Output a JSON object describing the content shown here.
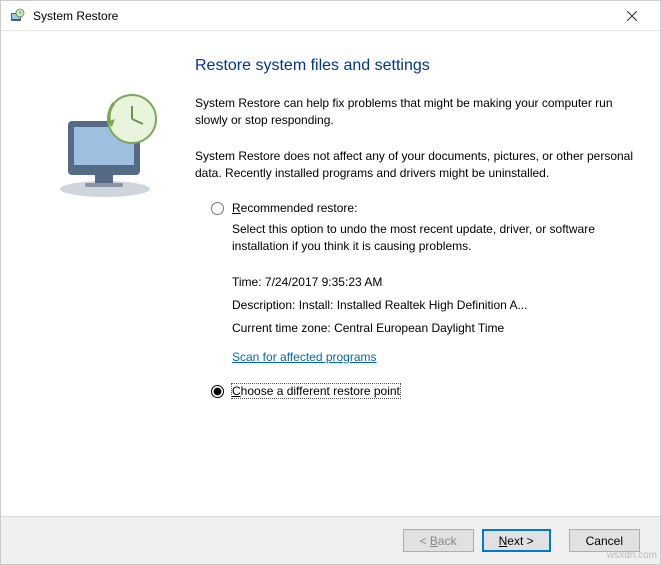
{
  "window": {
    "title": "System Restore"
  },
  "heading": "Restore system files and settings",
  "description1": "System Restore can help fix problems that might be making your computer run slowly or stop responding.",
  "description2": "System Restore does not affect any of your documents, pictures, or other personal data. Recently installed programs and drivers might be uninstalled.",
  "options": {
    "recommended": {
      "label": "Recommended restore:",
      "desc": "Select this option to undo the most recent update, driver, or software installation if you think it is causing problems.",
      "time_label": "Time:",
      "time_value": "7/24/2017 9:35:23 AM",
      "desc_label": "Description:",
      "desc_value": "Install: Installed Realtek High Definition A...",
      "tz_label": "Current time zone:",
      "tz_value": "Central European Daylight Time",
      "scan_link": "Scan for affected programs"
    },
    "different": {
      "label": "Choose a different restore point"
    }
  },
  "buttons": {
    "back": "Back",
    "next": "Next",
    "cancel": "Cancel"
  },
  "watermark": "",
  "sourcemark": "wsxdn.com"
}
